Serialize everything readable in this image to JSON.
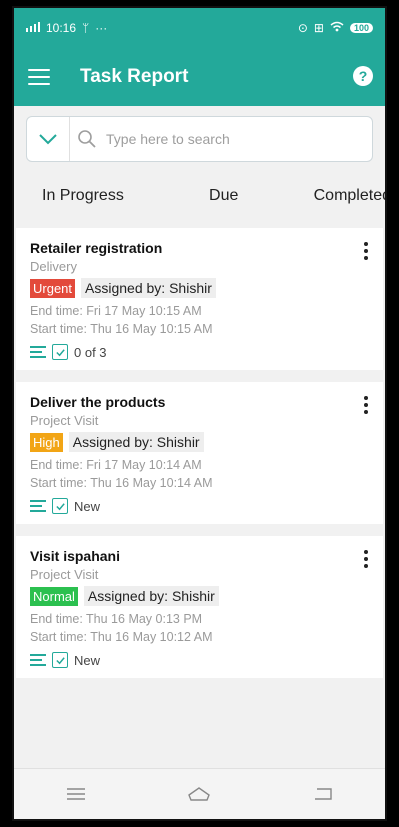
{
  "status_bar": {
    "time": "10:16",
    "battery": "100"
  },
  "app_bar": {
    "title": "Task Report",
    "help_glyph": "?"
  },
  "search": {
    "placeholder": "Type here to search"
  },
  "tabs": [
    {
      "label": "In Progress"
    },
    {
      "label": "Due"
    },
    {
      "label": "Completed"
    }
  ],
  "tasks": [
    {
      "title": "Retailer registration",
      "category": "Delivery",
      "priority": "Urgent",
      "priority_color": "#e34a3b",
      "assigned": "Assigned by: Shishir",
      "end_time": "End time: Fri 17 May 10:15 AM",
      "start_time": "Start time: Thu 16 May 10:15 AM",
      "progress": "0 of 3"
    },
    {
      "title": "Deliver the products",
      "category": "Project Visit",
      "priority": "High",
      "priority_color": "#f2a515",
      "assigned": "Assigned by: Shishir",
      "end_time": "End time: Fri 17 May 10:14 AM",
      "start_time": "Start time: Thu 16 May 10:14 AM",
      "progress": "New"
    },
    {
      "title": "Visit ispahani",
      "category": "Project Visit",
      "priority": "Normal",
      "priority_color": "#2bc04f",
      "assigned": "Assigned by: Shishir",
      "end_time": "End time: Thu 16 May 0:13 PM",
      "start_time": "Start time: Thu 16 May 10:12 AM",
      "progress": "New"
    }
  ],
  "colors": {
    "primary": "#23a99a"
  },
  "icons": {
    "menu": "hamburger-icon",
    "help": "help-icon",
    "dropdown": "chevron-down-icon",
    "search": "search-icon",
    "more": "more-vertical-icon",
    "description": "lines-icon",
    "checklist": "checkbox-icon",
    "nav_menu": "nav-menu-icon",
    "nav_home": "home-icon",
    "nav_back": "back-icon"
  }
}
